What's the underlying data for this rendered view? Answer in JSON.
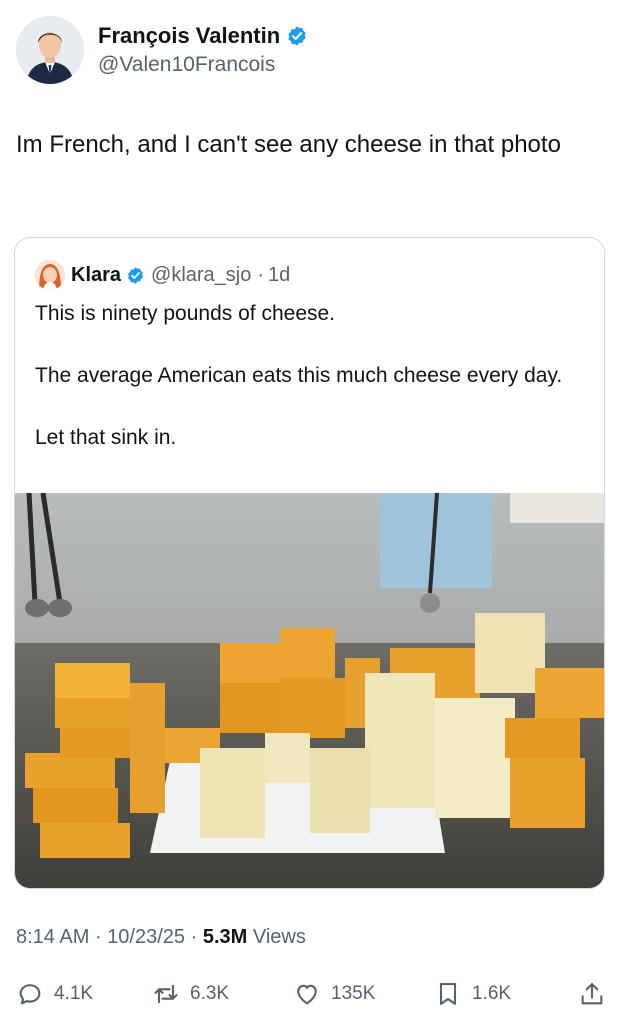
{
  "author": {
    "name": "François Valentin",
    "handle": "@Valen10Francois",
    "verified_icon": "verified-badge-icon"
  },
  "tweet": {
    "text": "Im French, and I can't see any cheese in that photo"
  },
  "quoted_tweet": {
    "name": "Klara",
    "handle": "@klara_sjo",
    "separator": "·",
    "time": "1d",
    "paragraphs": [
      "This is ninety pounds of cheese.",
      "The average American eats this much cheese every day.",
      "Let that sink in."
    ],
    "image_icon": "photo-of-cheese-blocks"
  },
  "meta": {
    "time": "8:14 AM",
    "separator": "·",
    "date": "10/23/25",
    "views_count": "5.3M",
    "views_label": "Views"
  },
  "actions": {
    "replies": "4.1K",
    "reposts": "6.3K",
    "likes": "135K",
    "bookmarks": "1.6K"
  },
  "colors": {
    "accent": "#1d9bf0",
    "text": "#0f1419",
    "secondary": "#536471",
    "border": "#cfd9de"
  }
}
